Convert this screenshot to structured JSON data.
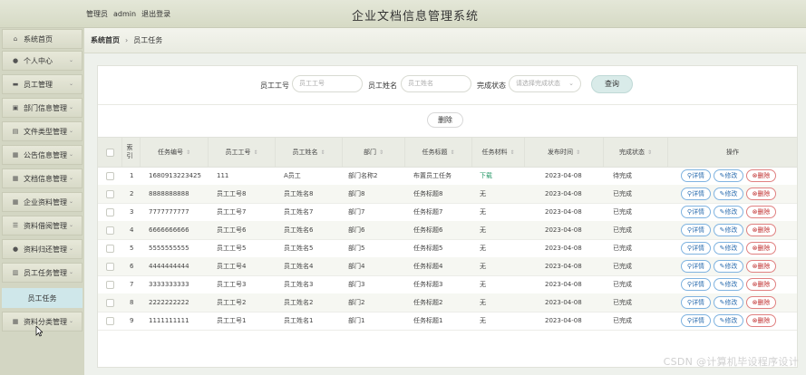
{
  "header": {
    "admin_prefix": "管理员",
    "username": "admin",
    "logout": "退出登录",
    "app_title": "企业文档信息管理系统"
  },
  "sidebar": {
    "items": [
      {
        "label": "系统首页",
        "icon": "home-icon",
        "glyph": "⌂"
      },
      {
        "label": "个人中心",
        "icon": "user-icon",
        "glyph": "●"
      },
      {
        "label": "员工管理",
        "icon": "staff-icon",
        "glyph": "▬"
      },
      {
        "label": "部门信息管理",
        "icon": "department-icon",
        "glyph": "▣"
      },
      {
        "label": "文件类型管理",
        "icon": "file-type-icon",
        "glyph": "▤"
      },
      {
        "label": "公告信息管理",
        "icon": "notice-icon",
        "glyph": "▦"
      },
      {
        "label": "文档信息管理",
        "icon": "document-icon",
        "glyph": "▦"
      },
      {
        "label": "企业资料管理",
        "icon": "company-info-icon",
        "glyph": "▦"
      },
      {
        "label": "资料借阅管理",
        "icon": "borrow-icon",
        "glyph": "☰"
      },
      {
        "label": "资料归还管理",
        "icon": "return-icon",
        "glyph": "●"
      },
      {
        "label": "员工任务管理",
        "icon": "task-icon",
        "glyph": "▥"
      }
    ],
    "sub_item": "员工任务",
    "last_item": {
      "label": "资料分类管理",
      "icon": "category-icon",
      "glyph": "▦"
    }
  },
  "breadcrumb": {
    "home": "系统首页",
    "separator": "›",
    "current": "员工任务"
  },
  "search": {
    "emp_no_label": "员工工号",
    "emp_no_placeholder": "员工工号",
    "emp_name_label": "员工姓名",
    "emp_name_placeholder": "员工姓名",
    "status_label": "完成状态",
    "status_placeholder": "请选择完成状态",
    "query_button": "查询"
  },
  "delete_button": "删除",
  "table": {
    "columns": [
      "索引",
      "任务编号",
      "员工工号",
      "员工姓名",
      "部门",
      "任务标题",
      "任务材料",
      "发布时间",
      "完成状态",
      "操作"
    ],
    "actions": {
      "view": "详情",
      "edit": "修改",
      "delete": "删除"
    },
    "rows": [
      {
        "idx": "1",
        "task_no": "1680913223425",
        "emp_no": "111",
        "emp_name": "A员工",
        "dept": "部门名称2",
        "title": "布置员工任务",
        "material": "下载",
        "date": "2023-04-08",
        "status": "待完成"
      },
      {
        "idx": "2",
        "task_no": "8888888888",
        "emp_no": "员工工号8",
        "emp_name": "员工姓名8",
        "dept": "部门8",
        "title": "任务标题8",
        "material": "无",
        "date": "2023-04-08",
        "status": "已完成"
      },
      {
        "idx": "3",
        "task_no": "7777777777",
        "emp_no": "员工工号7",
        "emp_name": "员工姓名7",
        "dept": "部门7",
        "title": "任务标题7",
        "material": "无",
        "date": "2023-04-08",
        "status": "已完成"
      },
      {
        "idx": "4",
        "task_no": "6666666666",
        "emp_no": "员工工号6",
        "emp_name": "员工姓名6",
        "dept": "部门6",
        "title": "任务标题6",
        "material": "无",
        "date": "2023-04-08",
        "status": "已完成"
      },
      {
        "idx": "5",
        "task_no": "5555555555",
        "emp_no": "员工工号5",
        "emp_name": "员工姓名5",
        "dept": "部门5",
        "title": "任务标题5",
        "material": "无",
        "date": "2023-04-08",
        "status": "已完成"
      },
      {
        "idx": "6",
        "task_no": "4444444444",
        "emp_no": "员工工号4",
        "emp_name": "员工姓名4",
        "dept": "部门4",
        "title": "任务标题4",
        "material": "无",
        "date": "2023-04-08",
        "status": "已完成"
      },
      {
        "idx": "7",
        "task_no": "3333333333",
        "emp_no": "员工工号3",
        "emp_name": "员工姓名3",
        "dept": "部门3",
        "title": "任务标题3",
        "material": "无",
        "date": "2023-04-08",
        "status": "已完成"
      },
      {
        "idx": "8",
        "task_no": "2222222222",
        "emp_no": "员工工号2",
        "emp_name": "员工姓名2",
        "dept": "部门2",
        "title": "任务标题2",
        "material": "无",
        "date": "2023-04-08",
        "status": "已完成"
      },
      {
        "idx": "9",
        "task_no": "1111111111",
        "emp_no": "员工工号1",
        "emp_name": "员工姓名1",
        "dept": "部门1",
        "title": "任务标题1",
        "material": "无",
        "date": "2023-04-08",
        "status": "已完成"
      }
    ]
  },
  "watermark": "CSDN @计算机毕设程序设计",
  "colors": {
    "link": "#2f6fb0",
    "danger": "#c03030",
    "download": "#2a9a6a"
  }
}
